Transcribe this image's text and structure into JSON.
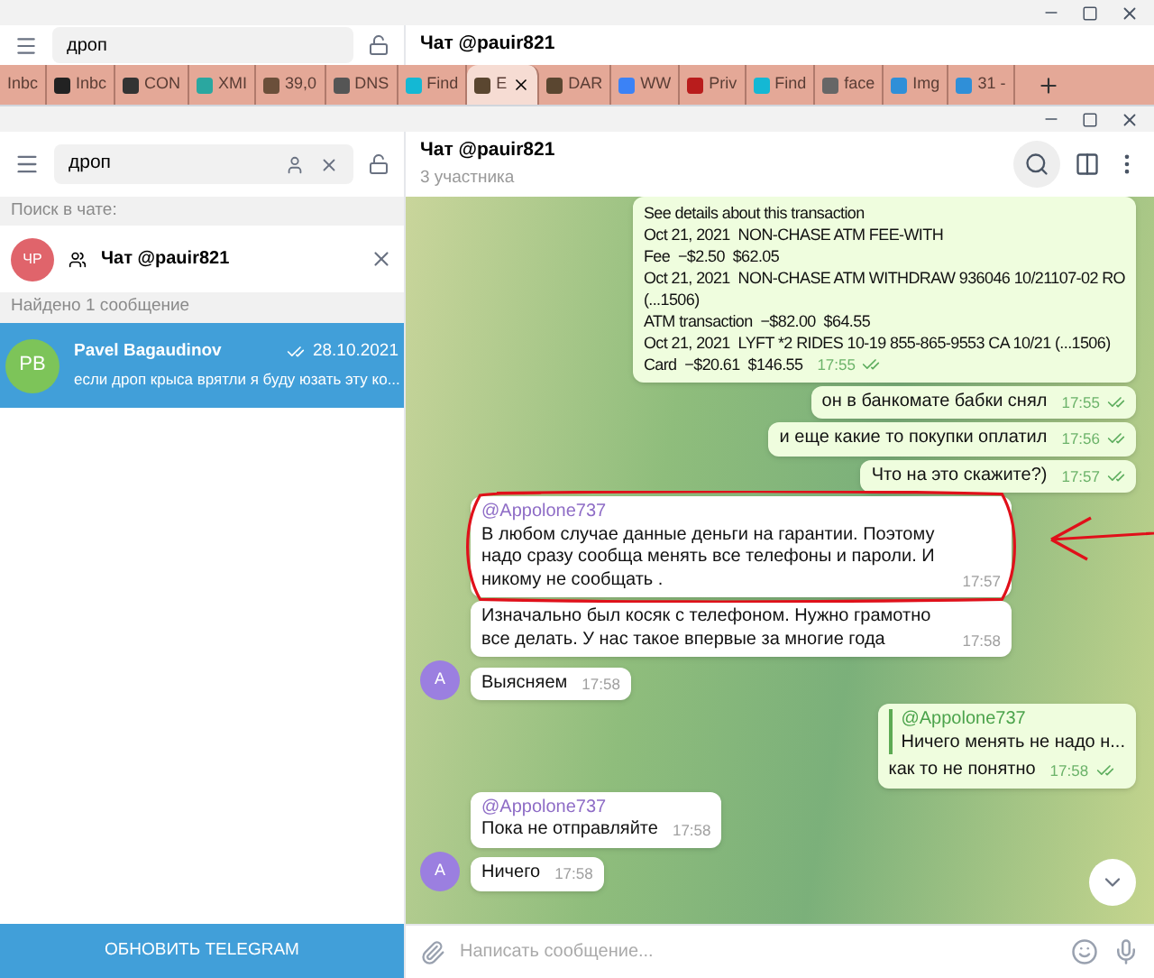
{
  "back_window": {
    "search": {
      "value": "дроп"
    },
    "chat_title": "Чат @pauir821"
  },
  "browser_tabs": [
    {
      "label": "Inbc",
      "selected": false
    },
    {
      "label": "Inbc",
      "selected": false,
      "color": "#222222"
    },
    {
      "label": "CON",
      "selected": false,
      "color": "#333333"
    },
    {
      "label": "XMI",
      "selected": false,
      "color": "#2aa7a0"
    },
    {
      "label": "39,0",
      "selected": false,
      "color": "#6b4f3a"
    },
    {
      "label": "DNS",
      "selected": false,
      "color": "#555555"
    },
    {
      "label": "Find",
      "selected": false,
      "color": "#14b8d4"
    },
    {
      "label": "E",
      "selected": true,
      "color": "#5a4630"
    },
    {
      "label": "DAR",
      "selected": false,
      "color": "#5a4630"
    },
    {
      "label": "WW",
      "selected": false,
      "color": "#3b82f6"
    },
    {
      "label": "Priv",
      "selected": false,
      "color": "#b91c1c"
    },
    {
      "label": "Find",
      "selected": false,
      "color": "#14b8d4"
    },
    {
      "label": "face",
      "selected": false,
      "color": "#666666"
    },
    {
      "label": "Img",
      "selected": false,
      "color": "#2f8fd8"
    },
    {
      "label": "31 -",
      "selected": false,
      "color": "#2f8fd8"
    }
  ],
  "sidebar": {
    "search": {
      "value": "дроп"
    },
    "search_in_chat_label": "Поиск в чате:",
    "chat": {
      "avatar": "ЧР",
      "title": "Чат @pauir821"
    },
    "found_label": "Найдено 1 сообщение",
    "results": [
      {
        "avatar": "PB",
        "name": "Pavel Bagaudinov",
        "date": "28.10.2021",
        "preview": "если дроп крыса врятли я буду юзать эту ко...",
        "selected": true
      }
    ],
    "update_button": "ОБНОВИТЬ TELEGRAM"
  },
  "chat": {
    "title": "Чат @pauir821",
    "subtitle": "3 участника",
    "messages": [
      {
        "kind": "out",
        "lines": [
          "See details about this transaction",
          "Oct 21, 2021  NON-CHASE ATM FEE-WITH",
          "Fee  −$2.50  $62.05",
          "Oct 21, 2021  NON-CHASE ATM WITHDRAW 936046 10/21107-02 RO",
          "(...1506)",
          "ATM transaction  −$82.00  $64.55",
          "Oct 21, 2021  LYFT *2 RIDES 10-19 855-865-9553 CA 10/21 (...1506)",
          "Card  −$20.61  $146.55"
        ],
        "time": "17:55",
        "read": true
      },
      {
        "kind": "out",
        "lines": [
          "он в банкомате бабки снял"
        ],
        "time": "17:55",
        "read": true
      },
      {
        "kind": "out",
        "lines": [
          "и еще какие то покупки оплатил"
        ],
        "time": "17:56",
        "read": true
      },
      {
        "kind": "out",
        "lines": [
          "Что на это скажите?)"
        ],
        "time": "17:57",
        "read": true
      },
      {
        "kind": "in",
        "author": "@Appolone737",
        "lines": [
          "В любом случае данные деньги на гарантии. Поэтому надо сразу сообща менять все телефоны и пароли. И никому не сообщать ."
        ],
        "time": "17:57",
        "circled": true
      },
      {
        "kind": "in",
        "lines": [
          "Изначально был косяк с телефоном. Нужно грамотно все делать. У нас такое впервые за многие года"
        ],
        "time": "17:58"
      },
      {
        "kind": "in",
        "lines": [
          "Выясняем"
        ],
        "time": "17:58",
        "avatar": "A"
      },
      {
        "kind": "out",
        "reply": {
          "author": "@Appolone737",
          "text": "Ничего менять не надо н..."
        },
        "lines": [
          "как то не понятно"
        ],
        "time": "17:58",
        "read": true
      },
      {
        "kind": "in",
        "author": "@Appolone737",
        "lines": [
          "Пока не отправляйте"
        ],
        "time": "17:58"
      },
      {
        "kind": "in",
        "lines": [
          "Ничего"
        ],
        "time": "17:58",
        "avatar": "A"
      }
    ],
    "composer": {
      "placeholder": "Написать сообщение..."
    }
  }
}
